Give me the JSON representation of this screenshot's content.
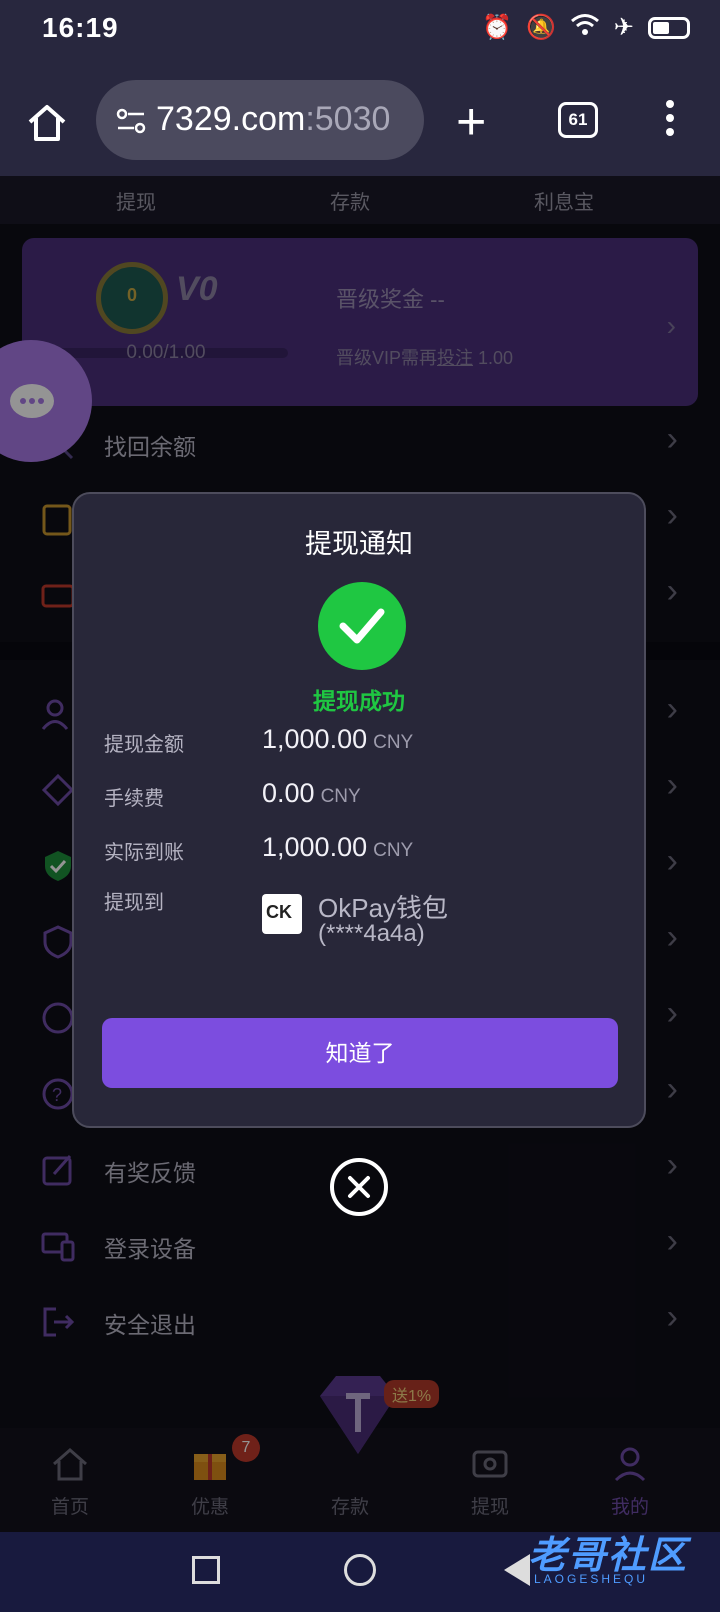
{
  "status_bar": {
    "time": "16:19"
  },
  "browser": {
    "url_main": "7329.com",
    "url_port": ":5030",
    "tab_count": "61"
  },
  "quick_nav": {
    "withdraw": "提现",
    "deposit": "存款",
    "interest": "利息宝"
  },
  "vip": {
    "level": "V0",
    "medal_level": "0",
    "progress_text": "0.00/1.00",
    "progress_fraction": 0.0,
    "bonus_label": "晋级奖金 --",
    "need_prefix": "晋级VIP需再",
    "need_link": "投注",
    "need_amount": "1.00"
  },
  "menu": {
    "recover_balance": "找回余额",
    "feedback": "有奖反馈",
    "devices": "登录设备",
    "logout": "安全退出"
  },
  "dialog": {
    "title": "提现通知",
    "status": "提现成功",
    "amount_label": "提现金额",
    "amount_value": "1,000.00",
    "fee_label": "手续费",
    "fee_value": "0.00",
    "actual_label": "实际到账",
    "actual_value": "1,000.00",
    "currency": "CNY",
    "dest_label": "提现到",
    "dest_logo": "CK",
    "dest_name": "OkPay钱包",
    "dest_account": "(****4a4a)",
    "confirm_label": "知道了"
  },
  "bottom_nav": {
    "home": "首页",
    "promo": "优惠",
    "deposit": "存款",
    "withdraw": "提现",
    "mine": "我的",
    "promo_badge": "7",
    "deposit_badge": "送1%",
    "active": "mine"
  },
  "watermark": {
    "main": "老哥社区",
    "sub": "LAOGESHEQU"
  },
  "colors": {
    "accent": "#7c4ddf",
    "success": "#1fc742",
    "vip_card": "#4a2f7b"
  }
}
